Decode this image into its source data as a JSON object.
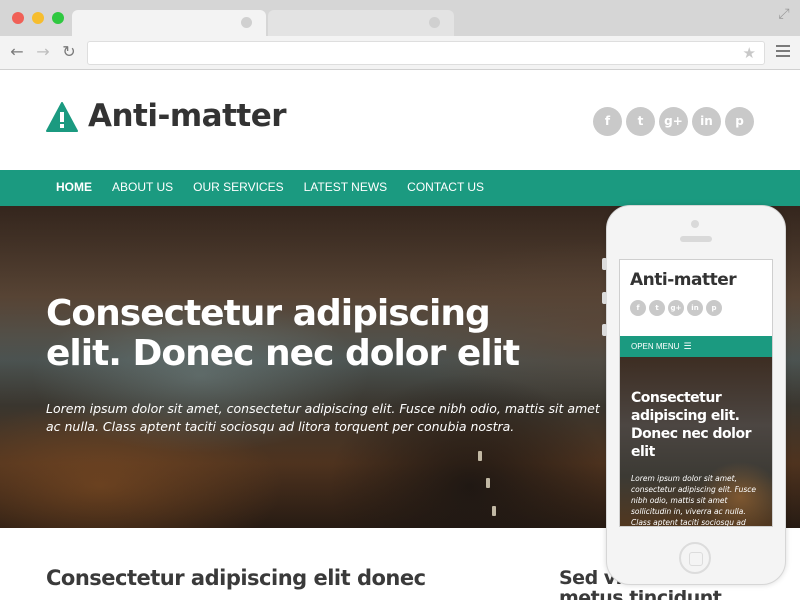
{
  "browser": {
    "url_value": "",
    "icons": {
      "back": "arrow-left-icon",
      "forward": "arrow-right-icon",
      "reload": "reload-icon",
      "bookmark": "star-icon",
      "menu": "hamburger-menu-icon",
      "fullscreen": "expand-icon"
    }
  },
  "site": {
    "logo_text": "Anti-matter",
    "logo_icon": "warning-triangle-icon",
    "socials": [
      {
        "name": "facebook-icon",
        "glyph": "f"
      },
      {
        "name": "twitter-icon",
        "glyph": "t"
      },
      {
        "name": "google-plus-icon",
        "glyph": "g+"
      },
      {
        "name": "linkedin-icon",
        "glyph": "in"
      },
      {
        "name": "pinterest-icon",
        "glyph": "p"
      }
    ],
    "nav": [
      "HOME",
      "ABOUT US",
      "OUR SERVICES",
      "LATEST NEWS",
      "CONTACT US"
    ],
    "hero": {
      "title": "Consectetur adipiscing elit. Donec nec dolor elit",
      "subtitle": "Lorem ipsum dolor sit amet, consectetur adipiscing elit. Fusce nibh odio, mattis sit amet ac nulla. Class aptent taciti sociosqu ad litora torquent per conubia nostra."
    },
    "content_heading": "Consectetur adipiscing elit donec",
    "aside_heading": "Sed vitae velit at metus tincidunt"
  },
  "mobile": {
    "logo_text": "Anti-matter",
    "menu_label": "OPEN MENU",
    "menu_icon": "hamburger-menu-icon",
    "hero_title": "Consectetur adipiscing elit. Donec nec dolor elit",
    "hero_subtitle": "Lorem ipsum dolor sit amet, consectetur adipiscing elit. Fusce nibh odio, mattis sit amet sollicitudin in, viverra ac nulla. Class aptent taciti sociosqu ad litora torquent per"
  },
  "colors": {
    "brand": "#1b9a80",
    "text_dark": "#333333",
    "social_gray": "#c9c9c9"
  }
}
